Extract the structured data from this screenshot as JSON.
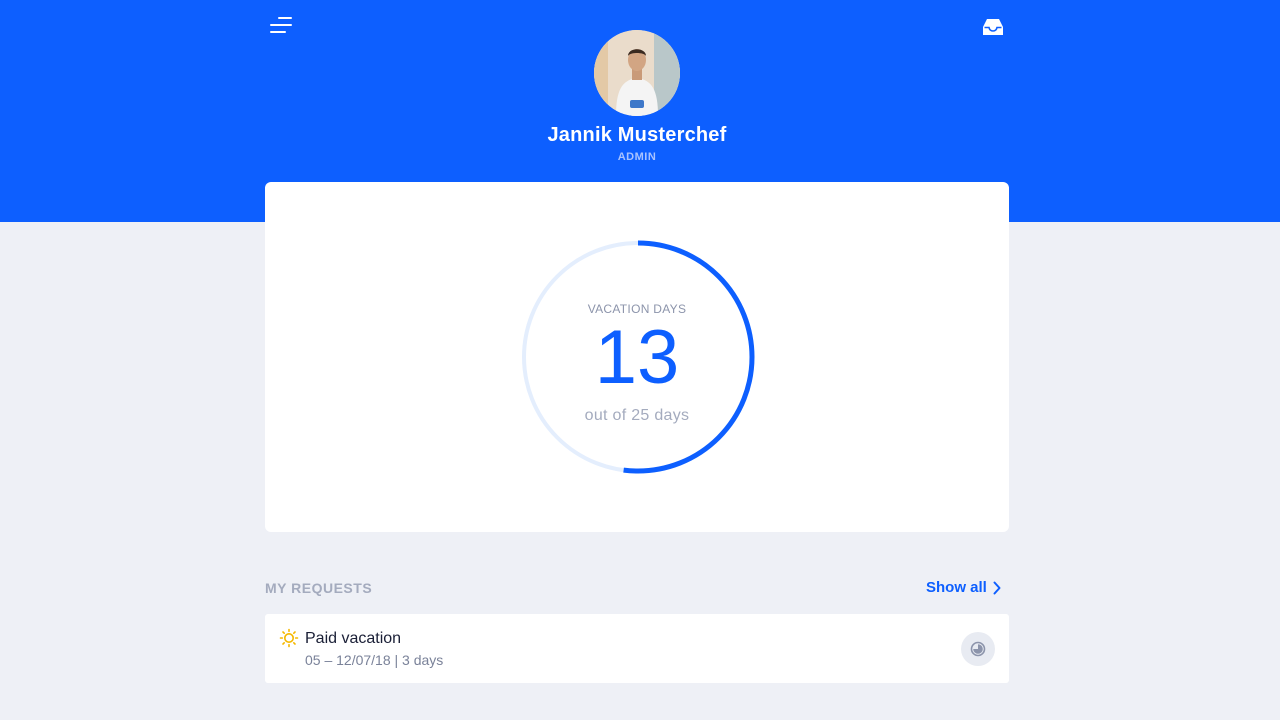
{
  "user": {
    "name": "Jannik Musterchef",
    "role": "ADMIN"
  },
  "header": {
    "menu_icon": "menu-icon",
    "inbox_icon": "inbox-icon",
    "accent_color": "#0D5FFF"
  },
  "vacation": {
    "label": "VACATION DAYS",
    "remaining": "13",
    "total_text": "out of 25 days",
    "remaining_days": 13,
    "total_days": 25
  },
  "requests": {
    "title": "MY REQUESTS",
    "show_all_label": "Show all",
    "items": [
      {
        "icon": "sun-icon",
        "title": "Paid vacation",
        "details": "05 – 12/07/18 | 3 days",
        "status_icon": "pending-clock-icon"
      }
    ]
  }
}
